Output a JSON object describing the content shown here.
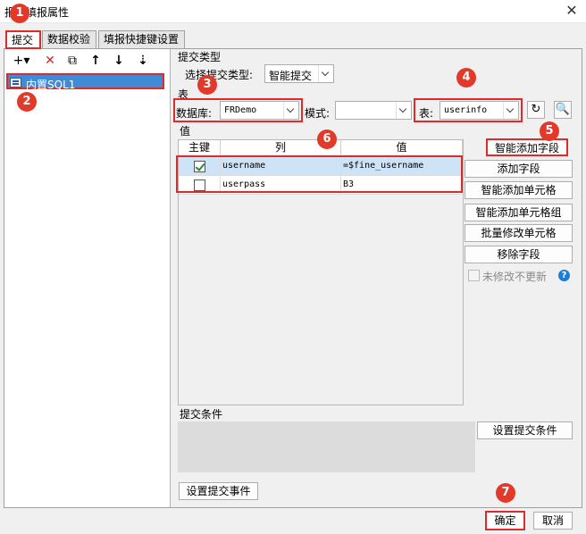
{
  "window": {
    "title": "报表填报属性",
    "close_icon": "close-icon"
  },
  "tabs": [
    {
      "label": "提交"
    },
    {
      "label": "数据校验"
    },
    {
      "label": "填报快捷键设置"
    }
  ],
  "toolbar": {
    "add": "+▾",
    "delete": "✕",
    "copy": "⧉",
    "up": "↑",
    "down": "↓",
    "sort": "⇣"
  },
  "tree": {
    "selected_item": "内置SQL1"
  },
  "submit_type": {
    "section_label": "提交类型",
    "select_label": "选择提交类型:",
    "value": "智能提交"
  },
  "table_section": {
    "section_label": "表",
    "db_label": "数据库:",
    "db_value": "FRDemo",
    "mode_label": "模式:",
    "mode_value": "",
    "table_label": "表:",
    "table_value": "userinfo",
    "refresh_icon": "refresh-icon",
    "preview_icon": "preview-icon"
  },
  "values_section": {
    "section_label": "值",
    "columns": [
      "主键",
      "列",
      "值"
    ],
    "rows": [
      {
        "key": true,
        "column": "username",
        "value": "=$fine_username"
      },
      {
        "key": false,
        "column": "userpass",
        "value": "B3"
      }
    ]
  },
  "side_buttons": {
    "smart_add_field": "智能添加字段",
    "add_field": "添加字段",
    "smart_add_cell": "智能添加单元格",
    "smart_add_cell_group": "智能添加单元格组",
    "batch_modify_cell": "批量修改单元格",
    "remove_field": "移除字段",
    "no_update_unmodified": "未修改不更新",
    "help_icon": "?"
  },
  "condition": {
    "section_label": "提交条件",
    "set_condition_button": "设置提交条件"
  },
  "event_button": "设置提交事件",
  "footer": {
    "ok": "确定",
    "cancel": "取消"
  },
  "annotations": [
    "1",
    "2",
    "3",
    "4",
    "5",
    "6",
    "7"
  ],
  "colors": {
    "annotation_red": "#e02a2a",
    "selection_blue": "#3f8bd6",
    "row_selected": "#cfe3f7"
  }
}
